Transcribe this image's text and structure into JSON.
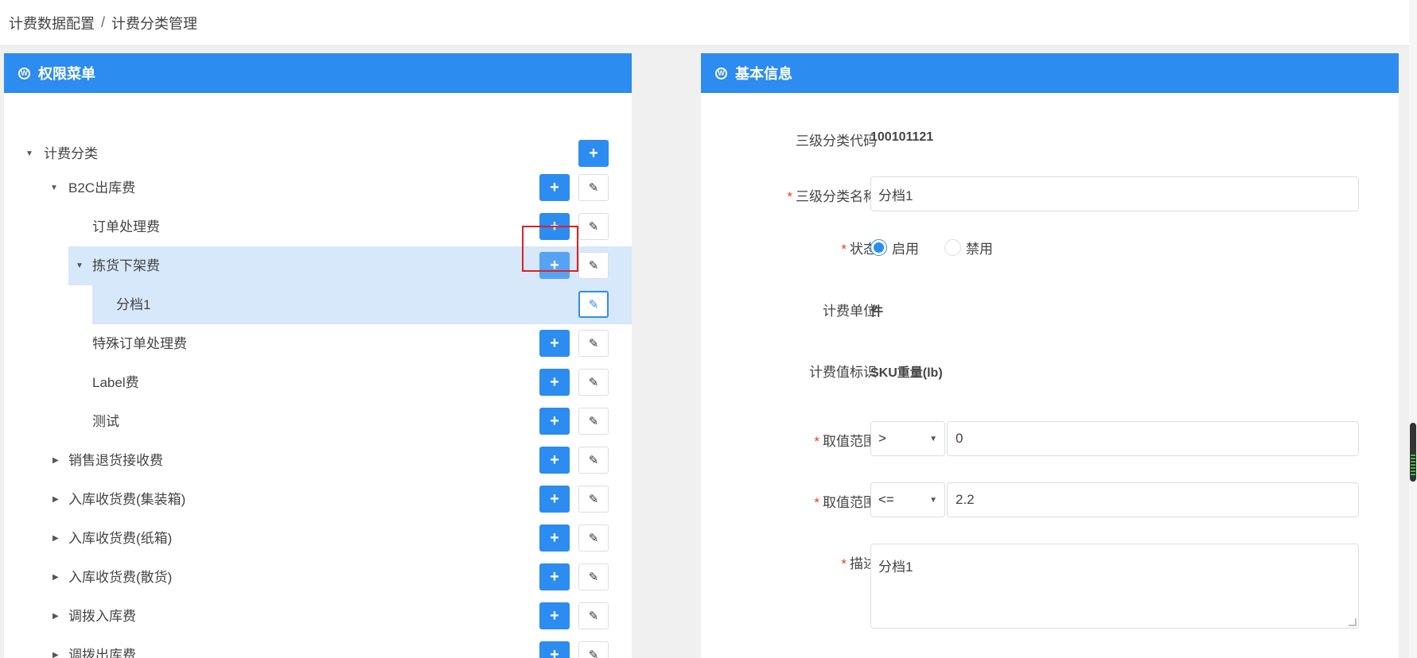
{
  "breadcrumb": {
    "items": [
      "计费数据配置",
      "计费分类管理"
    ],
    "separator": "/"
  },
  "left_panel": {
    "title": "权限菜单",
    "icon": "wordpress-icon",
    "tree": [
      {
        "label": "计费分类",
        "level": 0,
        "expanded": true,
        "buttons": [
          "add"
        ]
      },
      {
        "label": "B2C出库费",
        "level": 1,
        "expanded": true,
        "buttons": [
          "add",
          "edit"
        ]
      },
      {
        "label": "订单处理费",
        "level": 2,
        "leaf": true,
        "buttons": [
          "add",
          "edit"
        ]
      },
      {
        "label": "拣货下架费",
        "level": 2,
        "expanded": true,
        "selected_parent": true,
        "buttons": [
          "add",
          "edit"
        ]
      },
      {
        "label": "分档1",
        "level": 3,
        "leaf": true,
        "selected": true,
        "buttons": [
          "edit"
        ]
      },
      {
        "label": "特殊订单处理费",
        "level": 2,
        "leaf": true,
        "buttons": [
          "add",
          "edit"
        ]
      },
      {
        "label": "Label费",
        "level": 2,
        "leaf": true,
        "buttons": [
          "add",
          "edit"
        ]
      },
      {
        "label": "测试",
        "level": 2,
        "leaf": true,
        "buttons": [
          "add",
          "edit"
        ]
      },
      {
        "label": "销售退货接收费",
        "level": 1,
        "expanded": false,
        "buttons": [
          "add",
          "edit"
        ]
      },
      {
        "label": "入库收货费(集装箱)",
        "level": 1,
        "expanded": false,
        "buttons": [
          "add",
          "edit"
        ]
      },
      {
        "label": "入库收货费(纸箱)",
        "level": 1,
        "expanded": false,
        "buttons": [
          "add",
          "edit"
        ]
      },
      {
        "label": "入库收货费(散货)",
        "level": 1,
        "expanded": false,
        "buttons": [
          "add",
          "edit"
        ]
      },
      {
        "label": "调拨入库费",
        "level": 1,
        "expanded": false,
        "buttons": [
          "add",
          "edit"
        ]
      },
      {
        "label": "调拨出库费",
        "level": 1,
        "expanded": false,
        "buttons": [
          "add",
          "edit"
        ]
      }
    ],
    "add_symbol": "+",
    "edit_symbol": "✎"
  },
  "right_panel": {
    "title": "基本信息",
    "icon": "wordpress-icon",
    "fields": {
      "code": {
        "label": "三级分类代码",
        "value": "100101121"
      },
      "name": {
        "label": "三级分类名称",
        "value": "分档1",
        "required": true
      },
      "status": {
        "label": "状态",
        "required": true,
        "options": [
          "启用",
          "禁用"
        ],
        "selected": "启用"
      },
      "unit": {
        "label": "计费单位",
        "value": "件"
      },
      "metric": {
        "label": "计费值标识",
        "value": "SKU重量(lb)"
      },
      "range_min": {
        "label": "取值范围",
        "required": true,
        "operator": ">",
        "value": "0"
      },
      "range_max": {
        "label": "取值范围",
        "required": true,
        "operator": "<=",
        "value": "2.2"
      },
      "description": {
        "label": "描述",
        "required": true,
        "value": "分档1"
      }
    }
  },
  "colors": {
    "primary": "#2d8cf0",
    "selected_row": "#d6e8fa",
    "required": "#ed4014",
    "highlight_box": "#e02020"
  }
}
